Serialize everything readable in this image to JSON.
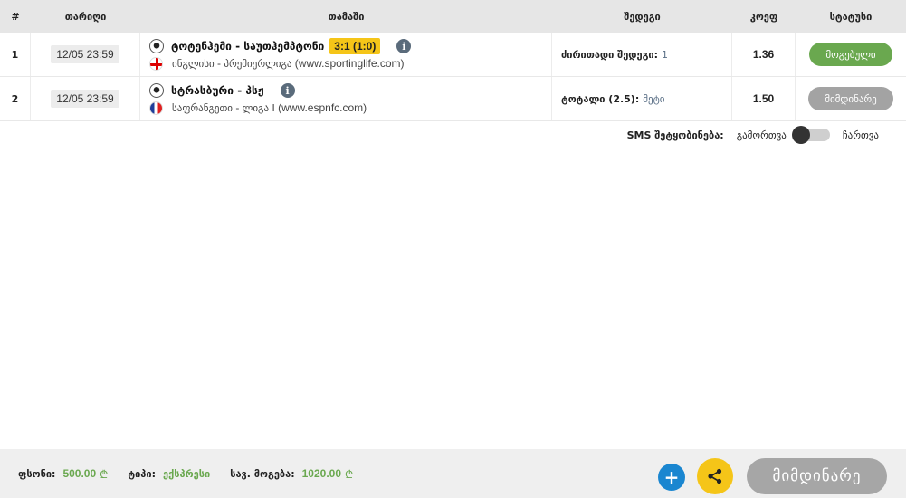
{
  "headers": {
    "num": "#",
    "date": "თარიღი",
    "game": "თამაში",
    "result": "შედეგი",
    "coef": "კოეფ",
    "status": "სტატუსი"
  },
  "rows": [
    {
      "num": "1",
      "date": "12/05 23:59",
      "game": "ტოტენჰემი - საუთჰემპტონი",
      "score": "3:1 (1:0)",
      "league_country": "ინგლისი",
      "league_name": "პრემიერლიგა",
      "league_source": "(www.sportinglife.com)",
      "result_label": "ძირითადი შედეგი:",
      "result_value": "1",
      "coef": "1.36",
      "status": "მოგებული"
    },
    {
      "num": "2",
      "date": "12/05 23:59",
      "game": "სტრასბური - პსჟ",
      "score": "",
      "league_country": "საფრანგეთი",
      "league_name": "ლიგა I",
      "league_source": "(www.espnfc.com)",
      "result_label": "ტოტალი (2.5):",
      "result_value": "მეტი",
      "coef": "1.50",
      "status": "მიმდინარე"
    }
  ],
  "sms": {
    "label": "SMS შეტყობინება:",
    "off": "გამორთვა",
    "on": "ჩართვა",
    "enabled": false
  },
  "footer": {
    "stake_label": "ფსონი:",
    "stake_value": "500.00",
    "type_label": "ტიპი:",
    "type_value": "ექსპრესი",
    "win_label": "სავ. მოგება:",
    "win_value": "1020.00",
    "currency": "₾",
    "status_button": "მიმდინარე"
  },
  "colors": {
    "won": "#6aa84f",
    "pending": "#a3a3a3",
    "score_bg": "#f5c518",
    "add_button": "#1a86d0",
    "share_button": "#f5c518"
  },
  "icons": [
    "football-icon",
    "info-icon",
    "england-flag-icon",
    "france-flag-icon",
    "plus-icon",
    "share-icon"
  ]
}
